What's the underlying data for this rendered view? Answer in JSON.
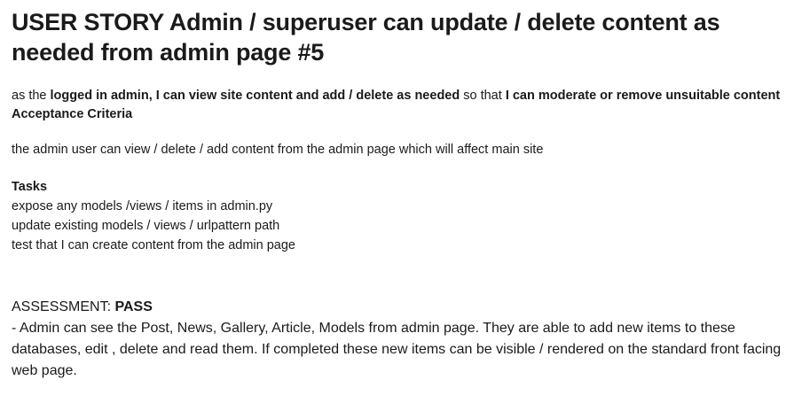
{
  "title": "USER STORY Admin / superuser can update / delete content as needed from admin page #5",
  "story": {
    "prefix": "as the ",
    "role": "logged in admin, I can view site content and add / delete as needed",
    "middle": " so that ",
    "goal": "I can moderate or remove unsuitable content"
  },
  "acceptance": {
    "heading": "Acceptance Criteria",
    "text": "the admin user can view / delete / add content from the admin page which will affect main site"
  },
  "tasks": {
    "heading": "Tasks",
    "items": [
      "expose any models /views / items in admin.py",
      "update existing models / views / urlpattern path",
      "test that I can create content from the admin page"
    ]
  },
  "assessment": {
    "label": "ASSESSMENT: ",
    "result": "PASS",
    "details": " - Admin can see the Post, News, Gallery, Article, Models from admin page. They are able to add new items to these databases, edit , delete and read them. If completed these new items can be visible / rendered on the standard front facing web page."
  }
}
